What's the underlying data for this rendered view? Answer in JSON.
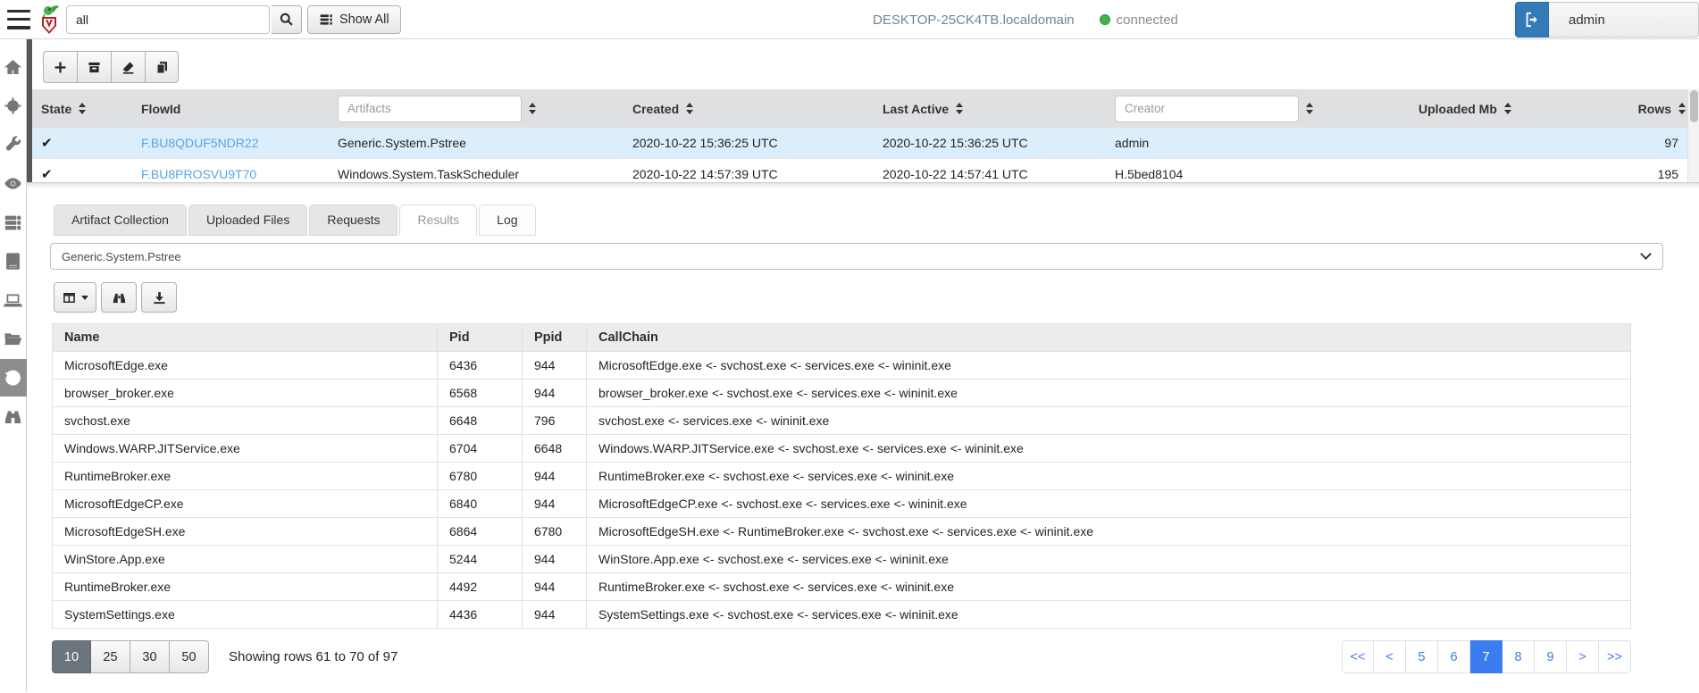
{
  "topbar": {
    "search_value": "all",
    "search_icon": "magnifier-icon",
    "show_all_label": "Show All",
    "hostname": "DESKTOP-25CK4TB.localdomain",
    "connection_status": "connected",
    "username": "admin"
  },
  "sidebar": {
    "items": [
      {
        "icon": "home-icon",
        "active": false
      },
      {
        "icon": "crosshair-icon",
        "active": false
      },
      {
        "icon": "wrench-icon",
        "active": false
      },
      {
        "icon": "eye-icon",
        "active": false
      },
      {
        "icon": "server-icon",
        "active": false
      },
      {
        "icon": "notebook-icon",
        "active": false
      },
      {
        "icon": "laptop-icon",
        "active": false
      },
      {
        "icon": "folder-open-icon",
        "active": false
      },
      {
        "icon": "history-icon",
        "active": true
      },
      {
        "icon": "binoculars-icon",
        "active": false
      }
    ]
  },
  "flows_toolbar": {
    "buttons": [
      "plus-icon",
      "archive-icon",
      "eraser-icon",
      "copy-icon"
    ]
  },
  "flows_table": {
    "columns": {
      "state": "State",
      "flow_id": "FlowId",
      "created": "Created",
      "last_active": "Last Active",
      "uploaded_mb": "Uploaded Mb",
      "rows": "Rows"
    },
    "artifacts_filter_placeholder": "Artifacts",
    "creator_filter_placeholder": "Creator",
    "rows": [
      {
        "state": "✔",
        "flow_id": "F.BU8QDUF5NDR22",
        "artifacts": "Generic.System.Pstree",
        "created": "2020-10-22 15:36:25 UTC",
        "last_active": "2020-10-22 15:36:25 UTC",
        "creator": "admin",
        "uploaded_mb": "",
        "rows": "97",
        "selected": true
      },
      {
        "state": "✔",
        "flow_id": "F.BU8PROSVU9T70",
        "artifacts": "Windows.System.TaskScheduler",
        "created": "2020-10-22 14:57:39 UTC",
        "last_active": "2020-10-22 14:57:41 UTC",
        "creator": "H.5bed8104",
        "uploaded_mb": "",
        "rows": "195",
        "selected": false
      }
    ]
  },
  "detail_panel": {
    "tabs": [
      {
        "label": "Artifact Collection",
        "variant": "gray"
      },
      {
        "label": "Uploaded Files",
        "variant": "gray"
      },
      {
        "label": "Requests",
        "variant": "gray"
      },
      {
        "label": "Results",
        "variant": "active"
      },
      {
        "label": "Log",
        "variant": "light"
      }
    ],
    "artifact_selector_value": "Generic.System.Pstree",
    "results_toolbar": {
      "buttons": [
        "table-columns-icon",
        "binoculars-icon",
        "download-icon"
      ]
    },
    "results_table": {
      "columns": [
        "Name",
        "Pid",
        "Ppid",
        "CallChain"
      ],
      "rows": [
        [
          "MicrosoftEdge.exe",
          "6436",
          "944",
          "MicrosoftEdge.exe <- svchost.exe <- services.exe <- wininit.exe"
        ],
        [
          "browser_broker.exe",
          "6568",
          "944",
          "browser_broker.exe <- svchost.exe <- services.exe <- wininit.exe"
        ],
        [
          "svchost.exe",
          "6648",
          "796",
          "svchost.exe <- services.exe <- wininit.exe"
        ],
        [
          "Windows.WARP.JITService.exe",
          "6704",
          "6648",
          "Windows.WARP.JITService.exe <- svchost.exe <- services.exe <- wininit.exe"
        ],
        [
          "RuntimeBroker.exe",
          "6780",
          "944",
          "RuntimeBroker.exe <- svchost.exe <- services.exe <- wininit.exe"
        ],
        [
          "MicrosoftEdgeCP.exe",
          "6840",
          "944",
          "MicrosoftEdgeCP.exe <- svchost.exe <- services.exe <- wininit.exe"
        ],
        [
          "MicrosoftEdgeSH.exe",
          "6864",
          "6780",
          "MicrosoftEdgeSH.exe <- RuntimeBroker.exe <- svchost.exe <- services.exe <- wininit.exe"
        ],
        [
          "WinStore.App.exe",
          "5244",
          "944",
          "WinStore.App.exe <- svchost.exe <- services.exe <- wininit.exe"
        ],
        [
          "RuntimeBroker.exe",
          "4492",
          "944",
          "RuntimeBroker.exe <- svchost.exe <- services.exe <- wininit.exe"
        ],
        [
          "SystemSettings.exe",
          "4436",
          "944",
          "SystemSettings.exe <- svchost.exe <- services.exe <- wininit.exe"
        ]
      ]
    },
    "pagination": {
      "page_sizes": [
        "10",
        "25",
        "30",
        "50"
      ],
      "active_page_size": "10",
      "status": "Showing rows 61 to 70 of 97",
      "pages": [
        "<<",
        "<",
        "5",
        "6",
        "7",
        "8",
        "9",
        ">",
        ">>"
      ],
      "active_page": "7"
    }
  },
  "colors": {
    "primary_blue": "#337ab7",
    "page_active_blue": "#3b7cf0",
    "link_blue": "#55a6e8",
    "selected_row": "#dceefc",
    "connected_green": "#3cb44a",
    "sidebar_active_bg": "#8d8d8d"
  }
}
